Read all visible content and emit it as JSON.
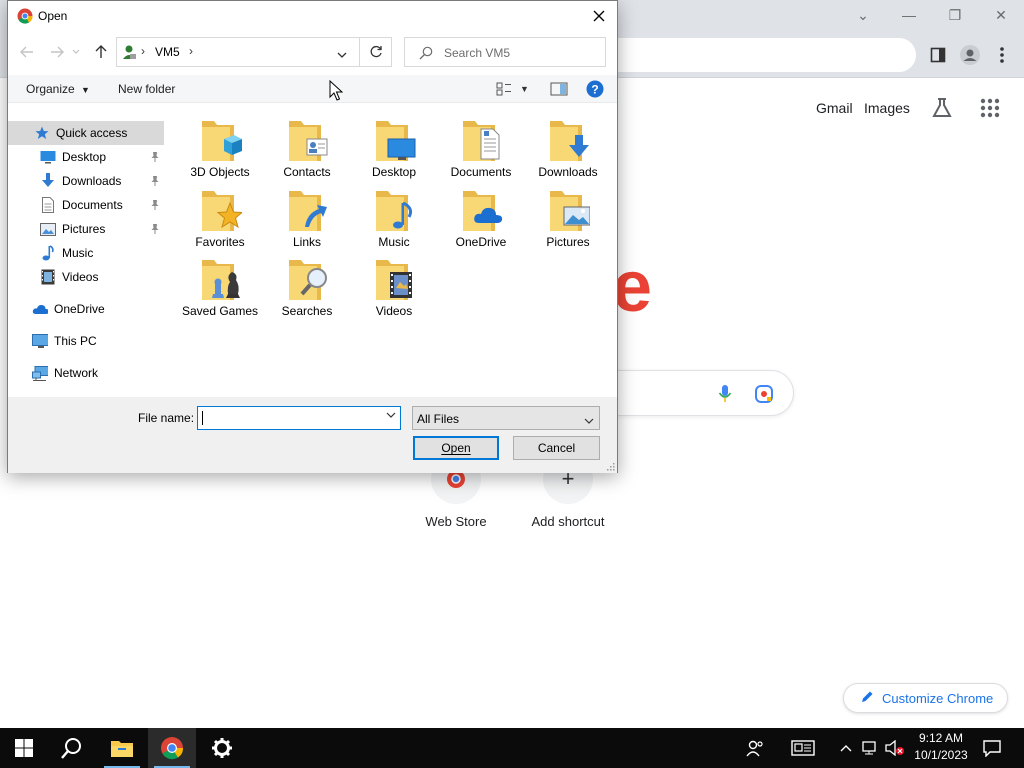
{
  "chrome": {
    "header_links": [
      "Gmail",
      "Images"
    ],
    "shortcuts": [
      {
        "label": "Web Store"
      },
      {
        "label": "Add shortcut"
      }
    ],
    "customize_label": "Customize Chrome",
    "logo_letter": "e"
  },
  "dialog": {
    "title": "Open",
    "address": {
      "location": "VM5"
    },
    "search_placeholder": "Search VM5",
    "commands": {
      "organize": "Organize",
      "new_folder": "New folder"
    },
    "nav": [
      {
        "label": "Quick access",
        "icon": "star-icon",
        "selected": true,
        "pinned": false
      },
      {
        "label": "Desktop",
        "icon": "desktop-icon",
        "selected": false,
        "pinned": true
      },
      {
        "label": "Downloads",
        "icon": "download-icon",
        "selected": false,
        "pinned": true
      },
      {
        "label": "Documents",
        "icon": "document-icon",
        "selected": false,
        "pinned": true
      },
      {
        "label": "Pictures",
        "icon": "pictures-icon",
        "selected": false,
        "pinned": true
      },
      {
        "label": "Music",
        "icon": "music-icon",
        "selected": false,
        "pinned": false
      },
      {
        "label": "Videos",
        "icon": "video-icon",
        "selected": false,
        "pinned": false
      },
      {
        "label": "OneDrive",
        "icon": "cloud-icon",
        "selected": false,
        "pinned": false
      },
      {
        "label": "This PC",
        "icon": "pc-icon",
        "selected": false,
        "pinned": false
      },
      {
        "label": "Network",
        "icon": "network-icon",
        "selected": false,
        "pinned": false
      }
    ],
    "folders": [
      {
        "label": "3D Objects",
        "overlay": "cube"
      },
      {
        "label": "Contacts",
        "overlay": "contact-card"
      },
      {
        "label": "Desktop",
        "overlay": "monitor"
      },
      {
        "label": "Documents",
        "overlay": "document"
      },
      {
        "label": "Downloads",
        "overlay": "download-arrow"
      },
      {
        "label": "Favorites",
        "overlay": "star"
      },
      {
        "label": "Links",
        "overlay": "link-arrow"
      },
      {
        "label": "Music",
        "overlay": "music-note"
      },
      {
        "label": "OneDrive",
        "overlay": "cloud"
      },
      {
        "label": "Pictures",
        "overlay": "landscape"
      },
      {
        "label": "Saved Games",
        "overlay": "chess-piece"
      },
      {
        "label": "Searches",
        "overlay": "magnifier"
      },
      {
        "label": "Videos",
        "overlay": "film"
      }
    ],
    "file_name_label": "File name:",
    "file_name_value": "",
    "file_type": "All Files",
    "open_button": "Open",
    "cancel_button": "Cancel"
  },
  "taskbar": {
    "time": "9:12 AM",
    "date": "10/1/2023"
  },
  "colors": {
    "accent": "#0078d7",
    "folder": "#f8d775",
    "folder_dark": "#e8b84a",
    "google_red": "#ea4335",
    "chrome_link": "#1a73e8"
  }
}
